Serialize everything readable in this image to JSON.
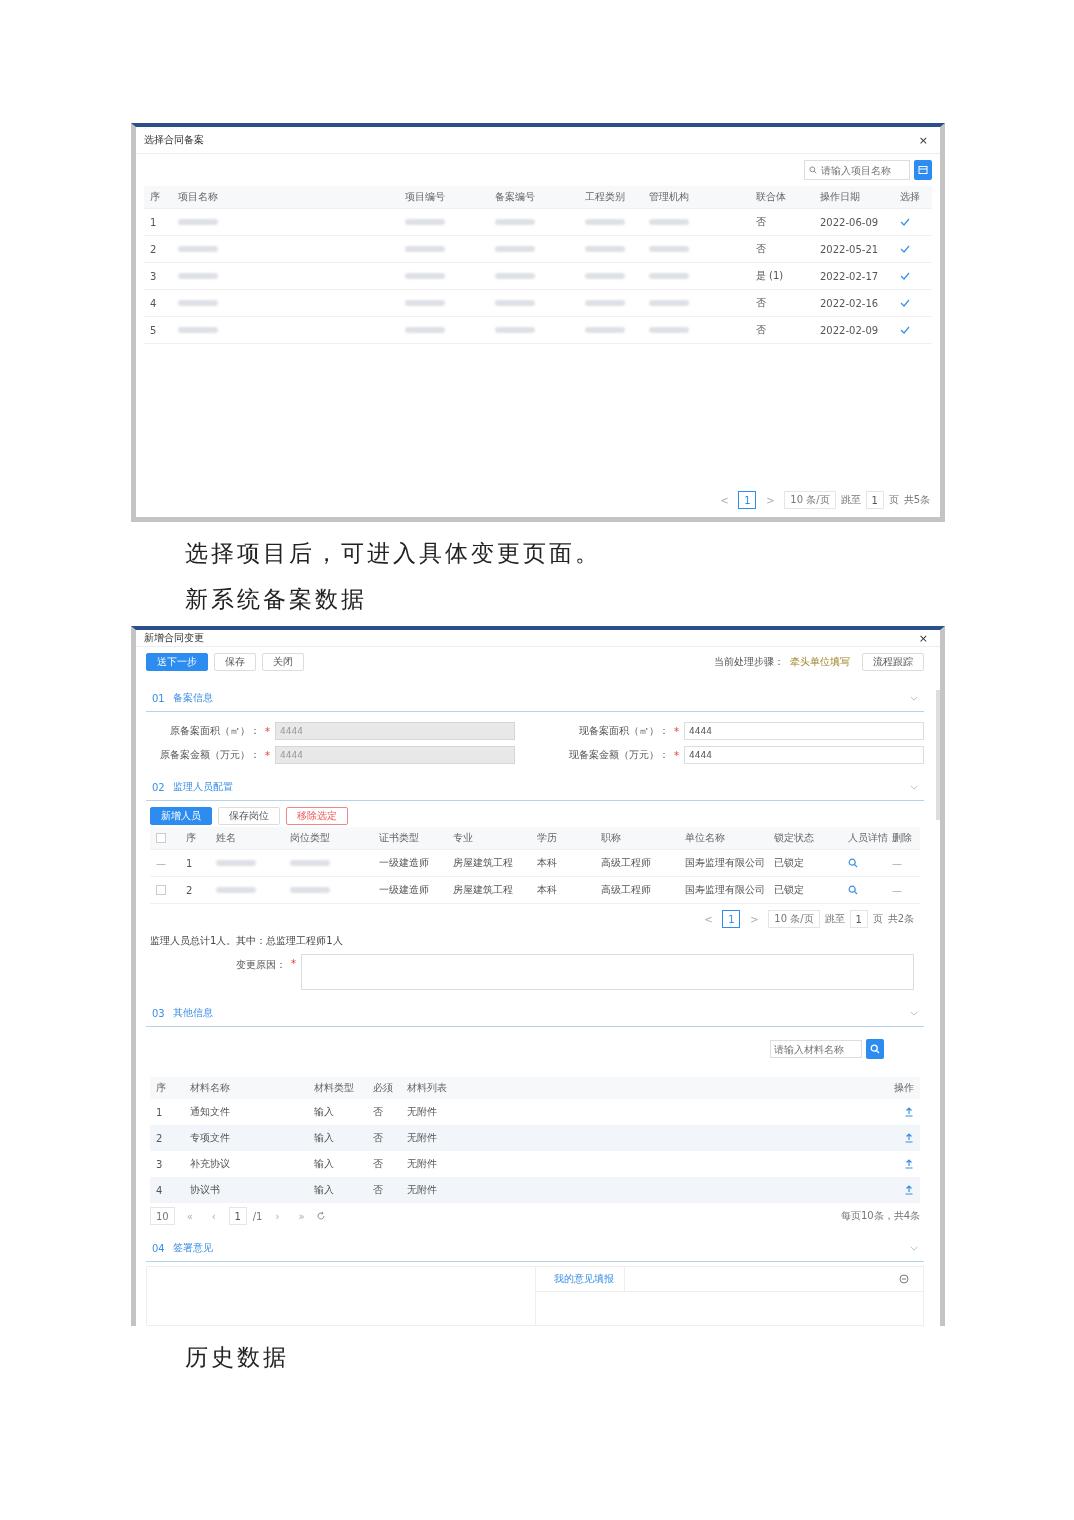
{
  "select_dialog": {
    "title": "选择合同备案",
    "close": "×",
    "search": {
      "placeholder": "请输入项目名称"
    },
    "columns": [
      "序",
      "项目名称",
      "项目编号",
      "备案编号",
      "工程类别",
      "管理机构",
      "联合体",
      "操作日期",
      "选择"
    ],
    "rows": [
      {
        "cells": [
          "1",
          null,
          null,
          null,
          null,
          null,
          "否",
          "2022-06-09"
        ]
      },
      {
        "cells": [
          "2",
          null,
          null,
          null,
          null,
          null,
          "否",
          "2022-05-21"
        ]
      },
      {
        "cells": [
          "3",
          null,
          null,
          null,
          null,
          null,
          "是 (1)",
          "2022-02-17"
        ]
      },
      {
        "cells": [
          "4",
          null,
          null,
          null,
          null,
          null,
          "否",
          "2022-02-16"
        ]
      },
      {
        "cells": [
          "5",
          null,
          null,
          null,
          null,
          null,
          "否",
          "2022-02-09"
        ]
      }
    ],
    "pager": {
      "prev": "<",
      "page": "1",
      "next": ">",
      "size": "10 条/页",
      "jump": "跳至",
      "jump_value": "1",
      "unit": "页",
      "total": "共5条"
    }
  },
  "text_after_select": [
    "选择项目后，可进入具体变更页面。",
    "新系统备案数据"
  ],
  "change_dialog": {
    "title": "新增合同变更",
    "close": "×",
    "actions": [
      {
        "label": "送下一步",
        "kind": "primary"
      },
      {
        "label": "保存",
        "kind": "plain"
      },
      {
        "label": "关闭",
        "kind": "plain"
      }
    ],
    "step_label": "当前处理步骤：",
    "step_value": "牵头单位填写",
    "track_button": "流程跟踪",
    "filing": {
      "number": "01",
      "title": "备案信息",
      "fields": [
        {
          "label": "原备案面积（㎡）：",
          "star": "*",
          "value": "4444",
          "disabled": true
        },
        {
          "label": "现备案面积（㎡）：",
          "star": "*",
          "value": "4444",
          "disabled": false
        },
        {
          "label": "原备案金额（万元）：",
          "star": "*",
          "value": "4444",
          "disabled": true
        },
        {
          "label": "现备案金额（万元）：",
          "star": "*",
          "value": "4444",
          "disabled": false
        }
      ]
    },
    "staff": {
      "number": "02",
      "title": "监理人员配置",
      "tabs": [
        {
          "label": "新增人员",
          "kind": "primary"
        },
        {
          "label": "保存岗位",
          "kind": "plain"
        },
        {
          "label": "移除选定",
          "kind": "danger"
        }
      ],
      "header_checked": false,
      "columns": [
        "序",
        "姓名",
        "岗位类型",
        "证书类型",
        "专业",
        "学历",
        "职称",
        "单位名称",
        "锁定状态",
        "人员详情",
        "删除"
      ],
      "rows": [
        {
          "mark": "—",
          "cells": [
            "1",
            null,
            null,
            "一级建造师",
            "房屋建筑工程",
            "本科",
            "高级工程师",
            "国寿监理有限公司",
            "已锁定"
          ],
          "delete": "—"
        },
        {
          "checked": false,
          "cells": [
            "2",
            null,
            null,
            "一级建造师",
            "房屋建筑工程",
            "本科",
            "高级工程师",
            "国寿监理有限公司",
            "已锁定"
          ],
          "delete": "—"
        }
      ],
      "pager": {
        "prev": "<",
        "page": "1",
        "next": ">",
        "size": "10 条/页",
        "jump": "跳至",
        "jump_value": "1",
        "unit": "页",
        "total": "共2条"
      },
      "summary": "监理人员总计1人。其中：总监理工程师1人",
      "reason": {
        "label": "变更原因：",
        "star": "*"
      }
    },
    "other": {
      "number": "03",
      "title": "其他信息",
      "search": {
        "placeholder": "请输入材料名称"
      },
      "columns": [
        "序",
        "材料名称",
        "材料类型",
        "必须",
        "材料列表",
        "操作"
      ],
      "rows": [
        {
          "cells": [
            "1",
            "通知文件",
            "输入",
            "否",
            "无附件"
          ]
        },
        {
          "cells": [
            "2",
            "专项文件",
            "输入",
            "否",
            "无附件"
          ]
        },
        {
          "cells": [
            "3",
            "补充协议",
            "输入",
            "否",
            "无附件"
          ]
        },
        {
          "cells": [
            "4",
            "协议书",
            "输入",
            "否",
            "无附件"
          ]
        }
      ],
      "pager": {
        "size": "10",
        "first": "«",
        "prev": "‹",
        "page": "1",
        "pages": "/1",
        "next": "›",
        "last": "»",
        "info": "每页10条，共4条"
      }
    },
    "opinion": {
      "number": "04",
      "title": "签署意见",
      "tab": "我的意见填报"
    }
  },
  "text_after_change": "历史数据"
}
